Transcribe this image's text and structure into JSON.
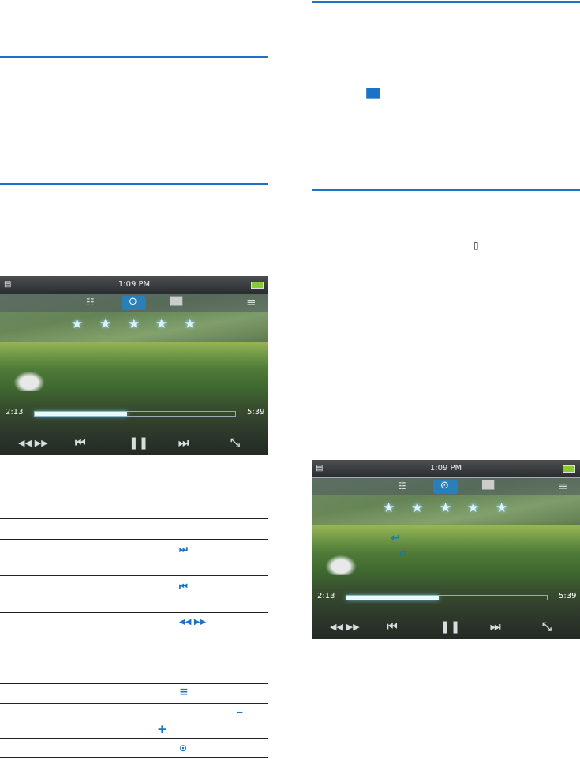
{
  "player": {
    "clock": "1:09 PM",
    "elapsed": "2:13",
    "total": "5:39",
    "progress_percent": 46,
    "rating_stars": 5
  },
  "icons": [
    "vibrate-icon",
    "video-icon",
    "next-icon",
    "previous-icon",
    "rewind-forward-icon",
    "menu-icon",
    "minus-icon",
    "plus-icon",
    "play-icon",
    "back-icon",
    "home-icon"
  ],
  "colors": {
    "accent": "#1a73c4"
  }
}
